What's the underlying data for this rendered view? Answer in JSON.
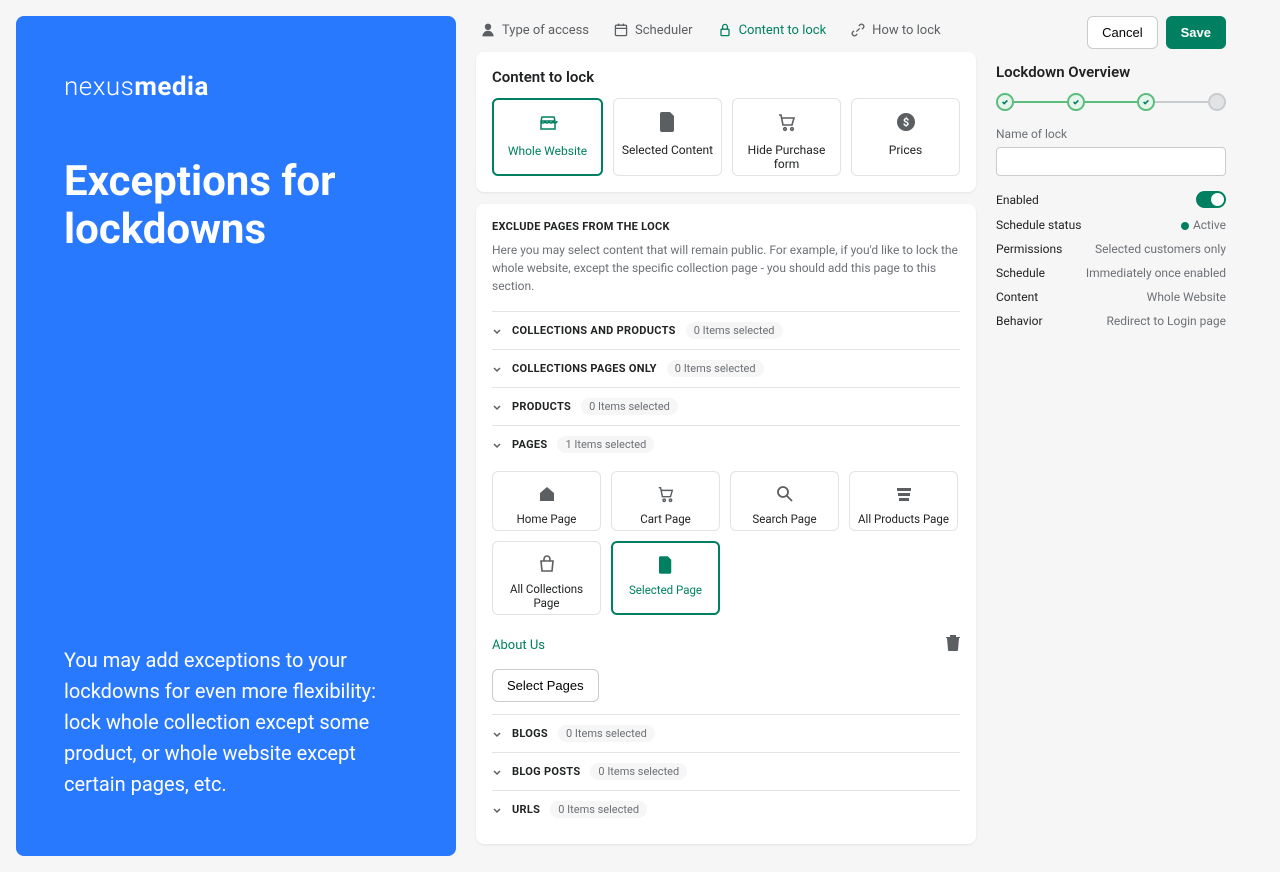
{
  "brand": {
    "a": "nexus",
    "b": "media"
  },
  "blue": {
    "title": "Exceptions for lockdowns",
    "desc": "You may add exceptions to your lockdowns for even more flexibility: lock whole collection except some product, or whole website except certain pages, etc."
  },
  "tabs": {
    "type_of_access": "Type of access",
    "scheduler": "Scheduler",
    "content_to_lock": "Content to lock",
    "how_to_lock": "How to lock"
  },
  "content_card": {
    "title": "Content to lock",
    "options": {
      "whole_website": "Whole Website",
      "selected_content": "Selected Content",
      "hide_purchase": "Hide Purchase form",
      "prices": "Prices"
    }
  },
  "exclude": {
    "title": "EXCLUDE PAGES FROM THE LOCK",
    "desc": "Here you may select content that will remain public. For example, if you'd like to lock the whole website, except the specific collection page - you should add this page to this section.",
    "sections": {
      "collections_products": {
        "label": "COLLECTIONS AND PRODUCTS",
        "badge": "0 Items selected"
      },
      "collections_pages": {
        "label": "COLLECTIONS PAGES ONLY",
        "badge": "0 Items selected"
      },
      "products": {
        "label": "PRODUCTS",
        "badge": "0 Items selected"
      },
      "pages": {
        "label": "PAGES",
        "badge": "1 Items selected"
      },
      "blogs": {
        "label": "BLOGS",
        "badge": "0 Items selected"
      },
      "blog_posts": {
        "label": "BLOG POSTS",
        "badge": "0 Items selected"
      },
      "urls": {
        "label": "URLS",
        "badge": "0 Items selected"
      }
    },
    "page_options": {
      "home": "Home Page",
      "cart": "Cart Page",
      "search": "Search Page",
      "all_products": "All Products Page",
      "all_collections": "All Collections Page",
      "selected_page": "Selected Page"
    },
    "selected_item": "About Us",
    "select_pages_btn": "Select Pages"
  },
  "top_buttons": {
    "cancel": "Cancel",
    "save": "Save"
  },
  "overview": {
    "title": "Lockdown Overview",
    "name_label": "Name of lock",
    "name_value": "",
    "rows": {
      "enabled": "Enabled",
      "schedule_status": {
        "k": "Schedule status",
        "v": "Active"
      },
      "permissions": {
        "k": "Permissions",
        "v": "Selected customers only"
      },
      "schedule": {
        "k": "Schedule",
        "v": "Immediately once enabled"
      },
      "content": {
        "k": "Content",
        "v": "Whole Website"
      },
      "behavior": {
        "k": "Behavior",
        "v": "Redirect to Login page"
      }
    }
  }
}
